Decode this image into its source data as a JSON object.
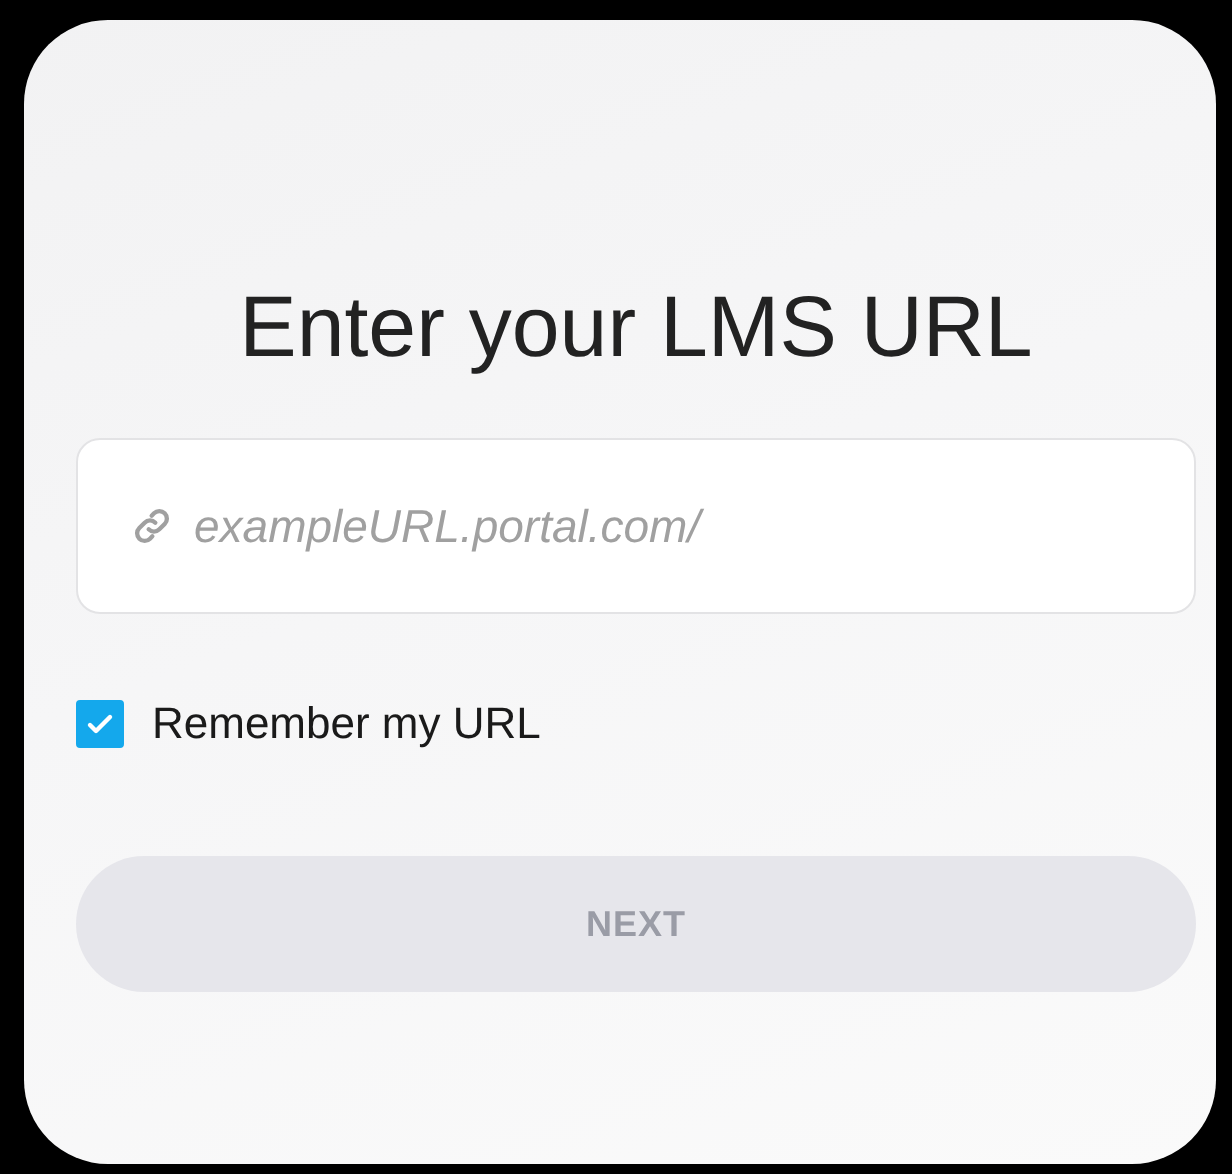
{
  "title": "Enter your LMS URL",
  "url_field": {
    "placeholder": "exampleURL.portal.com/"
  },
  "remember": {
    "label": "Remember my URL",
    "checked": true
  },
  "next_button": {
    "label": "NEXT",
    "disabled": true
  }
}
